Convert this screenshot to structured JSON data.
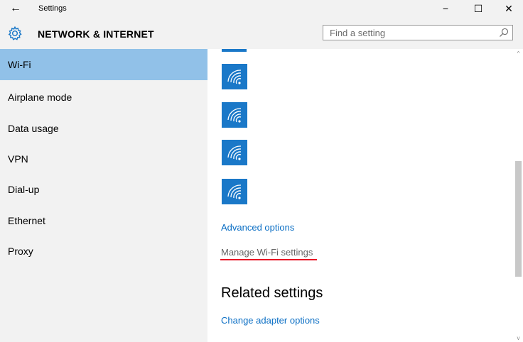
{
  "window": {
    "title": "Settings",
    "back_glyph": "←",
    "minimize_glyph": "−",
    "maximize_glyph": "☐",
    "close_glyph": "✕"
  },
  "header": {
    "icon": "gear-icon",
    "title": "NETWORK & INTERNET",
    "search": {
      "placeholder": "Find a setting",
      "icon": "search-icon"
    }
  },
  "sidebar": {
    "items": [
      {
        "label": "Wi-Fi",
        "active": true
      },
      {
        "label": "Airplane mode",
        "active": false
      },
      {
        "label": "Data usage",
        "active": false
      },
      {
        "label": "VPN",
        "active": false
      },
      {
        "label": "Dial-up",
        "active": false
      },
      {
        "label": "Ethernet",
        "active": false
      },
      {
        "label": "Proxy",
        "active": false
      }
    ]
  },
  "content": {
    "networks": [
      {
        "icon": "wifi-icon"
      },
      {
        "icon": "wifi-icon"
      },
      {
        "icon": "wifi-icon"
      },
      {
        "icon": "wifi-icon"
      }
    ],
    "advanced_options": "Advanced options",
    "manage_wifi": "Manage Wi-Fi settings",
    "related_heading": "Related settings",
    "change_adapter": "Change adapter options"
  },
  "colors": {
    "accent": "#1a78c8",
    "link": "#0a6ec4",
    "active_nav": "#91c1e8",
    "chrome_bg": "#f2f2f2",
    "highlight_underline": "#e81123"
  },
  "scrollbar": {
    "up_glyph": "^",
    "down_glyph": "v"
  }
}
